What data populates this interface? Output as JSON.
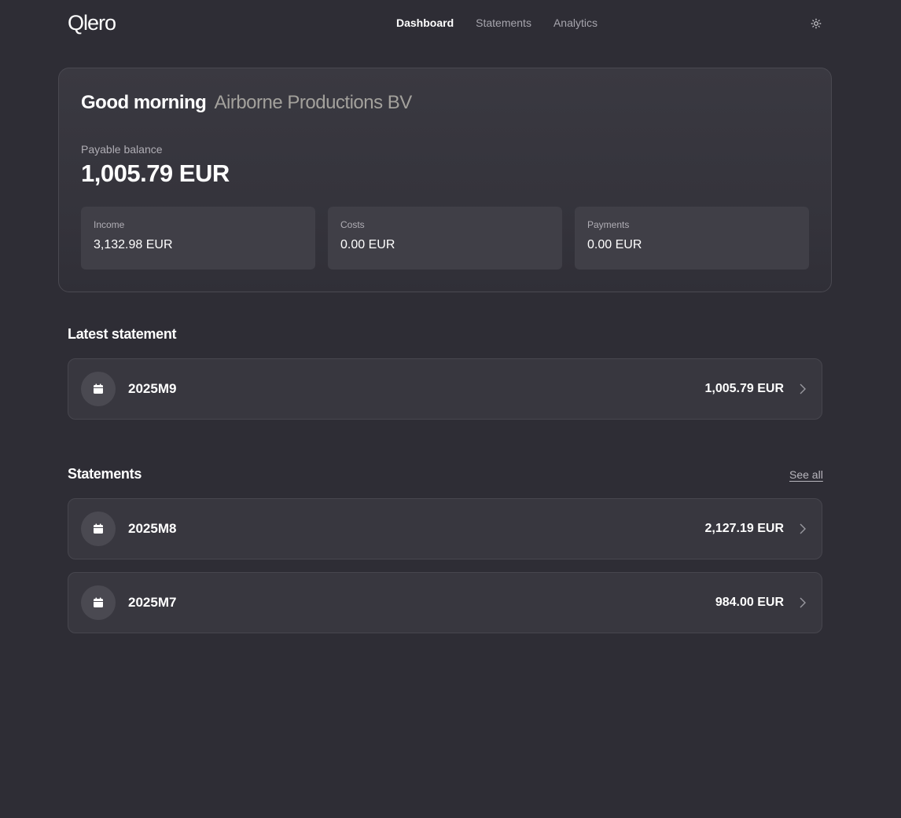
{
  "app": {
    "logo": "Qlero"
  },
  "nav": {
    "items": [
      {
        "label": "Dashboard",
        "active": true
      },
      {
        "label": "Statements",
        "active": false
      },
      {
        "label": "Analytics",
        "active": false
      }
    ],
    "theme_icon": "sun-icon"
  },
  "hero": {
    "greeting": "Good morning",
    "company": "Airborne Productions BV",
    "balance_label": "Payable balance",
    "balance_value": "1,005.79 EUR",
    "stats": [
      {
        "label": "Income",
        "value": "3,132.98 EUR"
      },
      {
        "label": "Costs",
        "value": "0.00 EUR"
      },
      {
        "label": "Payments",
        "value": "0.00 EUR"
      }
    ]
  },
  "latest": {
    "title": "Latest statement",
    "item": {
      "period": "2025M9",
      "amount": "1,005.79 EUR",
      "icon": "calendar-icon"
    }
  },
  "statements": {
    "title": "Statements",
    "see_all": "See all",
    "items": [
      {
        "period": "2025M8",
        "amount": "2,127.19 EUR",
        "icon": "calendar-icon"
      },
      {
        "period": "2025M7",
        "amount": "984.00 EUR",
        "icon": "calendar-icon"
      }
    ]
  },
  "colors": {
    "background": "#2e2d35",
    "card": "#38373f",
    "company_text": "#a3a19c",
    "muted_text": "#a6a5ad"
  }
}
